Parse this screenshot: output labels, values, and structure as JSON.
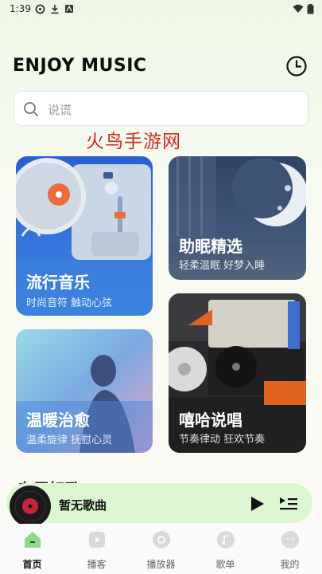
{
  "status_bar": {
    "time": "1:39",
    "left_icons": [
      "sync-icon",
      "download-icon",
      "app-icon"
    ],
    "right_icons": [
      "wifi-icon",
      "battery-icon"
    ]
  },
  "header": {
    "title": "ENJOY MUSIC",
    "history_icon": "clock-icon"
  },
  "search": {
    "placeholder": "说谎",
    "icon": "search-icon"
  },
  "watermark": "火鸟手游网",
  "cards": [
    {
      "id": "pop",
      "title": "流行音乐",
      "subtitle": "时尚音符 触动心弦",
      "color": "#3d7ee0"
    },
    {
      "id": "sleep",
      "title": "助眠精选",
      "subtitle": "轻柔温眠 好梦入睡",
      "color": "#3a4f6f"
    },
    {
      "id": "healing",
      "title": "温暖治愈",
      "subtitle": "温柔旋律 抚慰心灵",
      "color": "#4a8ad8"
    },
    {
      "id": "hiphop",
      "title": "嘻哈说唱",
      "subtitle": "节奏律动 狂欢节奏",
      "color": "#2b2b2b"
    }
  ],
  "section": {
    "title": "专属好歌"
  },
  "player": {
    "song_title": "暂无歌曲",
    "play_icon": "play-icon",
    "playlist_icon": "playlist-icon",
    "accent": "#dcf6d2"
  },
  "nav": {
    "items": [
      {
        "label": "首页",
        "icon": "home-icon",
        "active": true
      },
      {
        "label": "播客",
        "icon": "podcast-icon",
        "active": false
      },
      {
        "label": "播放器",
        "icon": "disc-icon",
        "active": false
      },
      {
        "label": "歌单",
        "icon": "music-note-icon",
        "active": false
      },
      {
        "label": "我的",
        "icon": "profile-icon",
        "active": false
      }
    ],
    "active_color": "#8fd98a"
  }
}
